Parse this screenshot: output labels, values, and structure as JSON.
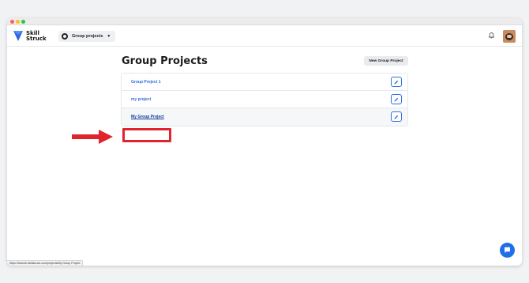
{
  "app": {
    "logo_line1": "Skill",
    "logo_line2": "Struck",
    "group_dropdown_label": "Group projects",
    "brand_color": "#2f6fe0"
  },
  "page": {
    "title": "Group Projects",
    "new_button_label": "New Group Project"
  },
  "projects": [
    {
      "name": "Group Project 1"
    },
    {
      "name": "my project"
    },
    {
      "name": "My Group Project"
    }
  ],
  "annotation": {
    "highlight_color": "#e0242e",
    "highlighted_project_index": 2
  },
  "status_bar": {
    "url": "https://teacher.skillstruck.com/projects/My Group Project"
  }
}
